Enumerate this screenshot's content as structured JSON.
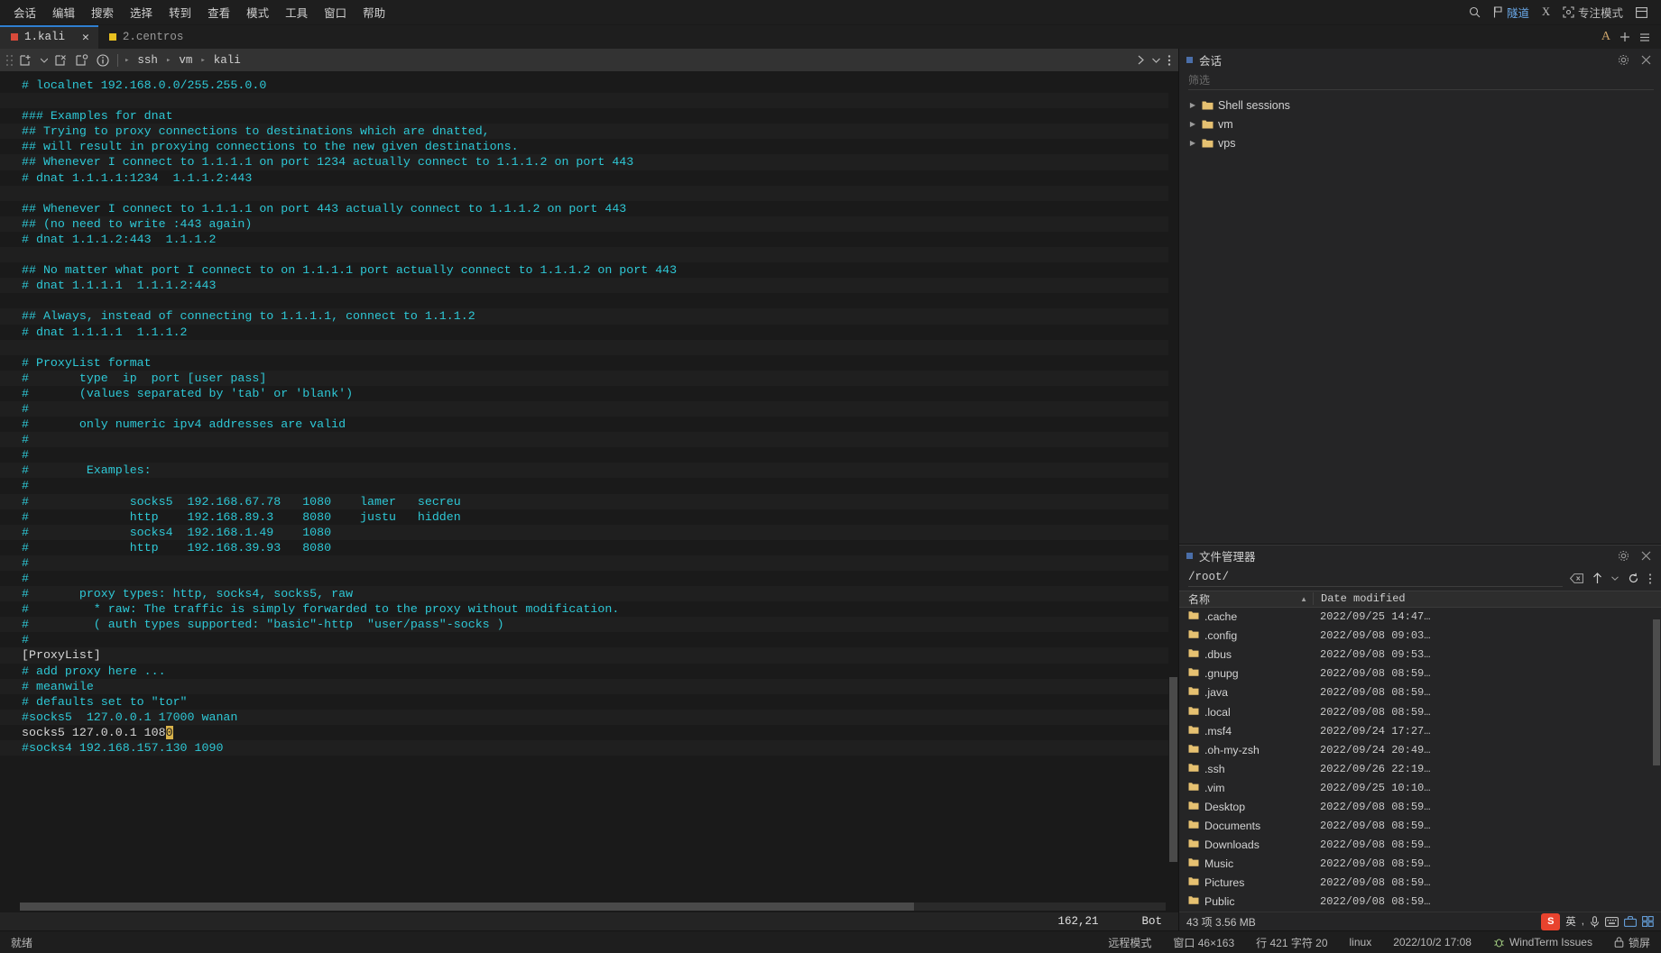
{
  "menubar": {
    "items": [
      {
        "label": "会话"
      },
      {
        "label": "编辑"
      },
      {
        "label": "搜索"
      },
      {
        "label": "选择"
      },
      {
        "label": "转到"
      },
      {
        "label": "查看"
      },
      {
        "label": "模式"
      },
      {
        "label": "工具"
      },
      {
        "label": "窗口"
      },
      {
        "label": "帮助"
      }
    ],
    "right": {
      "search_icon": "search-icon",
      "tunnel_label": "隧道",
      "x_label": "X",
      "focus_label": "专注模式",
      "layout_icon": "layout-icon"
    }
  },
  "tabs": {
    "items": [
      {
        "label": "1.kali",
        "color": "#d84a3a",
        "active": true,
        "closable": true
      },
      {
        "label": "2.centros",
        "color": "#e8c020",
        "active": false,
        "closable": false
      }
    ],
    "right_icons": [
      "font-icon",
      "add-tab-icon",
      "tab-menu-icon"
    ]
  },
  "breadcrumb": {
    "left_icons": [
      "new-session-icon",
      "close-session-icon",
      "reconnect-icon",
      "info-icon"
    ],
    "path": [
      "ssh",
      "vm",
      "kali"
    ],
    "separator": "▸",
    "right_icons": [
      "forward-icon",
      "chevron-down-icon",
      "more-icon"
    ]
  },
  "terminal": {
    "lines": [
      {
        "text": "# localnet 192.168.0.0/255.255.0.0",
        "style": "comment"
      },
      {
        "text": "",
        "style": "comment"
      },
      {
        "text": "### Examples for dnat",
        "style": "comment"
      },
      {
        "text": "## Trying to proxy connections to destinations which are dnatted,",
        "style": "comment"
      },
      {
        "text": "## will result in proxying connections to the new given destinations.",
        "style": "comment"
      },
      {
        "text": "## Whenever I connect to 1.1.1.1 on port 1234 actually connect to 1.1.1.2 on port 443",
        "style": "comment"
      },
      {
        "text": "# dnat 1.1.1.1:1234  1.1.1.2:443",
        "style": "comment"
      },
      {
        "text": "",
        "style": "comment"
      },
      {
        "text": "## Whenever I connect to 1.1.1.1 on port 443 actually connect to 1.1.1.2 on port 443",
        "style": "comment"
      },
      {
        "text": "## (no need to write :443 again)",
        "style": "comment"
      },
      {
        "text": "# dnat 1.1.1.2:443  1.1.1.2",
        "style": "comment"
      },
      {
        "text": "",
        "style": "comment"
      },
      {
        "text": "## No matter what port I connect to on 1.1.1.1 port actually connect to 1.1.1.2 on port 443",
        "style": "comment"
      },
      {
        "text": "# dnat 1.1.1.1  1.1.1.2:443",
        "style": "comment"
      },
      {
        "text": "",
        "style": "comment"
      },
      {
        "text": "## Always, instead of connecting to 1.1.1.1, connect to 1.1.1.2",
        "style": "comment"
      },
      {
        "text": "# dnat 1.1.1.1  1.1.1.2",
        "style": "comment"
      },
      {
        "text": "",
        "style": "comment"
      },
      {
        "text": "# ProxyList format",
        "style": "comment"
      },
      {
        "text": "#       type  ip  port [user pass]",
        "style": "comment"
      },
      {
        "text": "#       (values separated by 'tab' or 'blank')",
        "style": "comment"
      },
      {
        "text": "#",
        "style": "comment"
      },
      {
        "text": "#       only numeric ipv4 addresses are valid",
        "style": "comment"
      },
      {
        "text": "#",
        "style": "comment"
      },
      {
        "text": "#",
        "style": "comment"
      },
      {
        "text": "#        Examples:",
        "style": "comment"
      },
      {
        "text": "#",
        "style": "comment"
      },
      {
        "text": "#              socks5  192.168.67.78   1080    lamer   secreu",
        "style": "comment"
      },
      {
        "text": "#              http    192.168.89.3    8080    justu   hidden",
        "style": "comment"
      },
      {
        "text": "#              socks4  192.168.1.49    1080",
        "style": "comment"
      },
      {
        "text": "#              http    192.168.39.93   8080",
        "style": "comment"
      },
      {
        "text": "#",
        "style": "comment"
      },
      {
        "text": "#",
        "style": "comment"
      },
      {
        "text": "#       proxy types: http, socks4, socks5, raw",
        "style": "comment"
      },
      {
        "text": "#         * raw: The traffic is simply forwarded to the proxy without modification.",
        "style": "comment"
      },
      {
        "text": "#         ( auth types supported: \"basic\"-http  \"user/pass\"-socks )",
        "style": "comment"
      },
      {
        "text": "#",
        "style": "comment"
      },
      {
        "text": "[ProxyList]",
        "style": "plain"
      },
      {
        "text": "# add proxy here ...",
        "style": "comment"
      },
      {
        "text": "# meanwile",
        "style": "comment"
      },
      {
        "text": "# defaults set to \"tor\"",
        "style": "comment"
      },
      {
        "text": "#socks5  127.0.0.1 17000 wanan",
        "style": "comment"
      },
      {
        "text": "socks5 127.0.0.1 108",
        "style": "plain",
        "cursor_char": "0"
      },
      {
        "text": "#socks4 192.168.157.130 1090",
        "style": "comment"
      }
    ],
    "status": {
      "position": "162,21",
      "scroll": "Bot"
    }
  },
  "sessions_panel": {
    "title": "会话",
    "search_placeholder": "筛选",
    "gear_icon": "gear-icon",
    "close_icon": "close-icon",
    "tree": [
      {
        "label": "Shell sessions"
      },
      {
        "label": "vm"
      },
      {
        "label": "vps"
      }
    ]
  },
  "file_manager": {
    "title": "文件管理器",
    "gear_icon": "gear-icon",
    "close_icon": "close-icon",
    "path": "/root/",
    "toolbar_icons": [
      "clear-path-icon",
      "up-directory-icon",
      "history-dropdown-icon",
      "refresh-icon",
      "more-icon"
    ],
    "columns": [
      "名称",
      "Date modified"
    ],
    "sort_indicator": "▲",
    "rows": [
      {
        "name": ".cache",
        "date": "2022/09/25 14:47…"
      },
      {
        "name": ".config",
        "date": "2022/09/08 09:03…"
      },
      {
        "name": ".dbus",
        "date": "2022/09/08 09:53…"
      },
      {
        "name": ".gnupg",
        "date": "2022/09/08 08:59…"
      },
      {
        "name": ".java",
        "date": "2022/09/08 08:59…"
      },
      {
        "name": ".local",
        "date": "2022/09/08 08:59…"
      },
      {
        "name": ".msf4",
        "date": "2022/09/24 17:27…"
      },
      {
        "name": ".oh-my-zsh",
        "date": "2022/09/24 20:49…"
      },
      {
        "name": ".ssh",
        "date": "2022/09/26 22:19…"
      },
      {
        "name": ".vim",
        "date": "2022/09/25 10:10…"
      },
      {
        "name": "Desktop",
        "date": "2022/09/08 08:59…"
      },
      {
        "name": "Documents",
        "date": "2022/09/08 08:59…"
      },
      {
        "name": "Downloads",
        "date": "2022/09/08 08:59…"
      },
      {
        "name": "Music",
        "date": "2022/09/08 08:59…"
      },
      {
        "name": "Pictures",
        "date": "2022/09/08 08:59…"
      },
      {
        "name": "Public",
        "date": "2022/09/08 08:59…"
      }
    ],
    "footer": "43 项 3.56 MB"
  },
  "tray": {
    "ime_badge": "S",
    "ime_label": "英",
    "items": [
      "quote-icon",
      "mic-icon",
      "keyboard-icon",
      "toolbox-icon",
      "grid-icon"
    ]
  },
  "statusbar": {
    "ready": "就绪",
    "remote_mode": "远程模式",
    "window_size": "窗口 46×163",
    "cursor": "行 421 字符 20",
    "platform": "linux",
    "datetime": "2022/10/2 17:08",
    "issues": "WindTerm Issues",
    "lock": "锁屏"
  },
  "colors": {
    "accent_blue": "#2f7fd0",
    "terminal_comment": "#2ec8d6",
    "terminal_text": "#d6d6d6",
    "cursor": "#d8b24a",
    "tab1": "#d84a3a",
    "tab2": "#e8c020",
    "folder": "#e6c171"
  }
}
